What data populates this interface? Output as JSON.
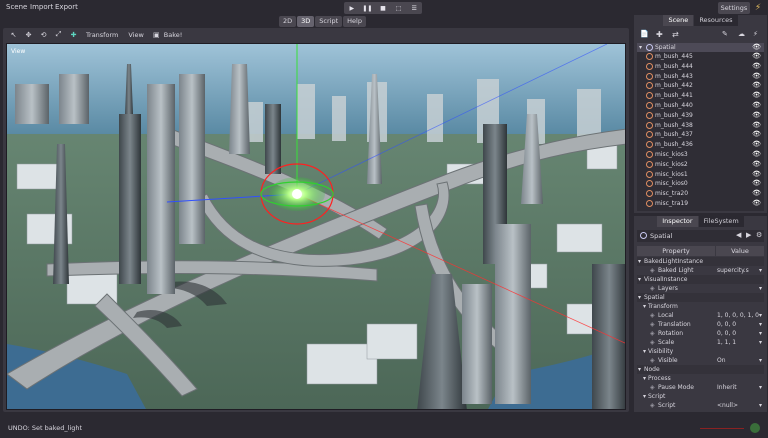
{
  "menu": {
    "scene": "Scene",
    "import": "Import",
    "export": "Export"
  },
  "play_controls": [
    "play-icon",
    "pause-icon",
    "stop-icon",
    "debug-icon",
    "options-icon"
  ],
  "settings": {
    "label": "Settings"
  },
  "modes": {
    "two_d": "2D",
    "three_d": "3D",
    "script": "Script",
    "help": "Help"
  },
  "viewport_toolbar": {
    "transform": "Transform",
    "view": "View",
    "bake": "Bake!"
  },
  "viewport": {
    "label": "View"
  },
  "status": {
    "text": "UNDO: Set baked_light"
  },
  "scene_dock": {
    "tabs": [
      "Scene",
      "Resources"
    ],
    "root": "Spatial",
    "nodes": [
      "m_bush_445",
      "m_bush_444",
      "m_bush_443",
      "m_bush_442",
      "m_bush_441",
      "m_bush_440",
      "m_bush_439",
      "m_bush_438",
      "m_bush_437",
      "m_bush_436",
      "misc_kios3",
      "misc_kios2",
      "misc_kios1",
      "misc_kios0",
      "misc_tra20",
      "misc_tra19"
    ]
  },
  "inspector": {
    "tabs": [
      "Inspector",
      "FileSystem"
    ],
    "node": "Spatial",
    "header": {
      "property": "Property",
      "value": "Value"
    },
    "rows": [
      {
        "kind": "section",
        "label": "BakedLightInstance"
      },
      {
        "kind": "prop",
        "label": "Baked Light",
        "value": "supercity.s"
      },
      {
        "kind": "section",
        "label": "VisualInstance"
      },
      {
        "kind": "prop",
        "label": "Layers",
        "value": ""
      },
      {
        "kind": "section",
        "label": "Spatial"
      },
      {
        "kind": "group",
        "label": "Transform"
      },
      {
        "kind": "prop",
        "label": "Local",
        "value": "1, 0, 0, 0, 1, 0"
      },
      {
        "kind": "prop",
        "label": "Translation",
        "value": "0, 0, 0"
      },
      {
        "kind": "prop",
        "label": "Rotation",
        "value": "0, 0, 0"
      },
      {
        "kind": "prop",
        "label": "Scale",
        "value": "1, 1, 1"
      },
      {
        "kind": "group",
        "label": "Visibility"
      },
      {
        "kind": "prop",
        "label": "Visible",
        "value": "On"
      },
      {
        "kind": "section",
        "label": "Node"
      },
      {
        "kind": "group",
        "label": "Process"
      },
      {
        "kind": "prop",
        "label": "Pause Mode",
        "value": "Inherit"
      },
      {
        "kind": "group",
        "label": "Script"
      },
      {
        "kind": "prop",
        "label": "Script",
        "value": "<null>"
      }
    ]
  },
  "colors": {
    "accent": "#5dd6c0",
    "panel": "#3a3841",
    "bg": "#2b2931",
    "tree": "#2f2d35"
  }
}
